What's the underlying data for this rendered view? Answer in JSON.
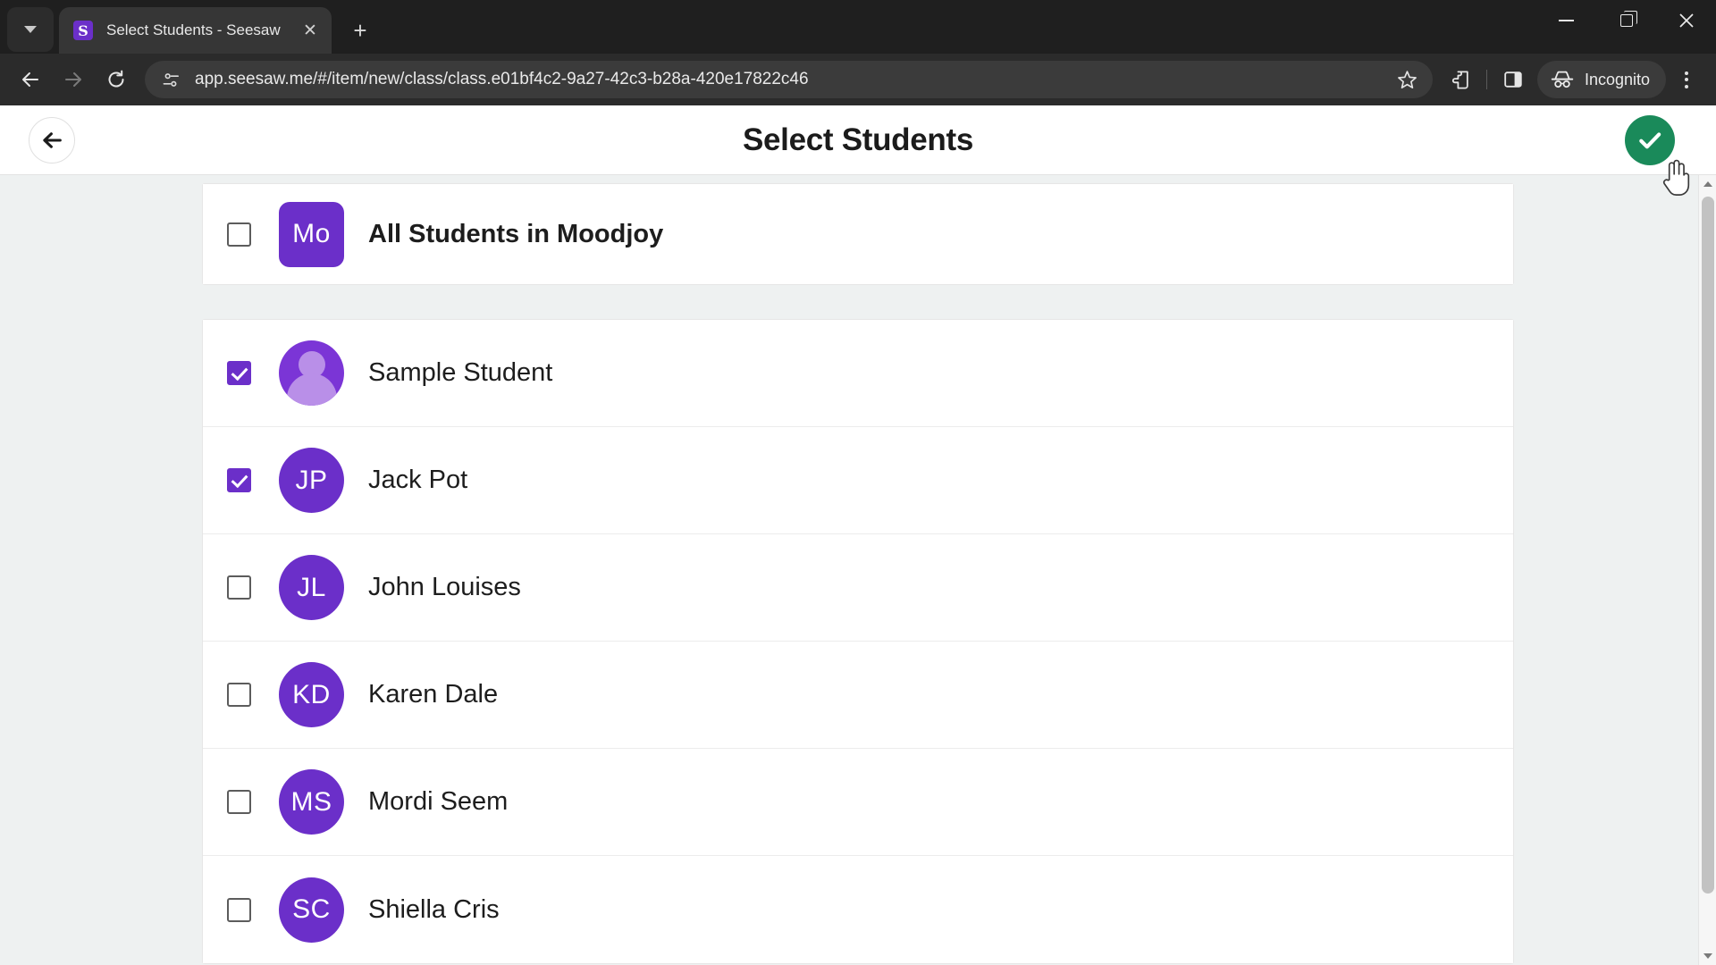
{
  "browser": {
    "tab": {
      "title": "Select Students - Seesaw",
      "favicon_letter": "S",
      "favicon_color": "#6b2fc9",
      "close_glyph": "✕"
    },
    "tab_search_icon": "chevron-down-icon",
    "new_tab_glyph": "+",
    "window_controls": {
      "minimize": "minimize",
      "maximize": "restore",
      "close": "close"
    },
    "toolbar": {
      "back": "back",
      "forward": "forward",
      "reload": "reload",
      "url": "app.seesaw.me/#/item/new/class/class.e01bf4c2-9a27-42c3-b28a-420e17822c46",
      "site_info_icon": "site-settings-icon",
      "bookmark_icon": "star-icon",
      "extensions_icon": "puzzle-icon",
      "side_panel_icon": "side-panel-icon",
      "incognito_label": "Incognito",
      "menu_icon": "kebab-menu-icon"
    }
  },
  "page": {
    "title": "Select Students",
    "back_label": "Back",
    "confirm_label": "Done",
    "confirm_color": "#1a8a5a",
    "accent_color": "#6b2fc9",
    "group": {
      "name": "All Students in Moodjoy",
      "initials": "Mo",
      "checked": false,
      "avatar_shape": "square"
    },
    "students": [
      {
        "name": "Sample Student",
        "initials": "",
        "checked": true,
        "avatar_shape": "silhouette"
      },
      {
        "name": "Jack Pot",
        "initials": "JP",
        "checked": true,
        "avatar_shape": "circle"
      },
      {
        "name": "John Louises",
        "initials": "JL",
        "checked": false,
        "avatar_shape": "circle"
      },
      {
        "name": "Karen Dale",
        "initials": "KD",
        "checked": false,
        "avatar_shape": "circle"
      },
      {
        "name": "Mordi Seem",
        "initials": "MS",
        "checked": false,
        "avatar_shape": "circle"
      },
      {
        "name": "Shiella Cris",
        "initials": "SC",
        "checked": false,
        "avatar_shape": "circle"
      }
    ]
  }
}
